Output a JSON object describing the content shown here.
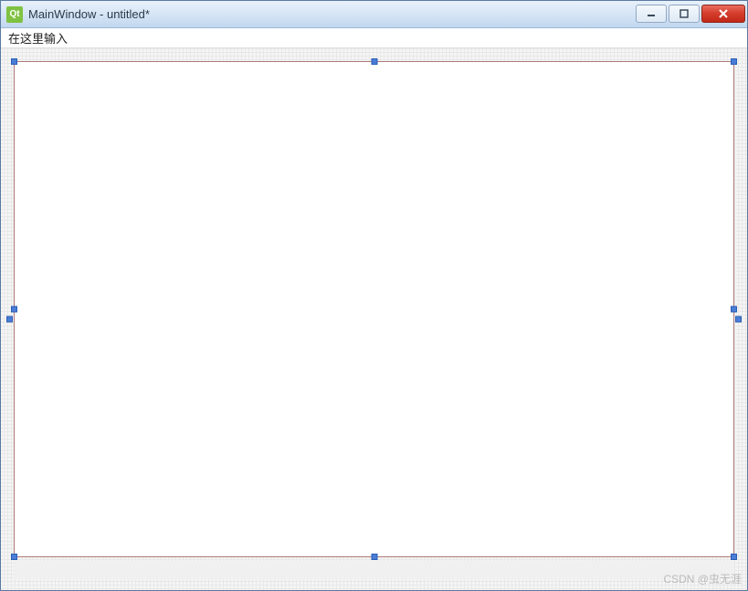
{
  "window": {
    "title": "MainWindow - untitled*",
    "icon_label": "Qt"
  },
  "menubar": {
    "placeholder_text": "在这里输入"
  },
  "watermark": "CSDN @虫无涯"
}
